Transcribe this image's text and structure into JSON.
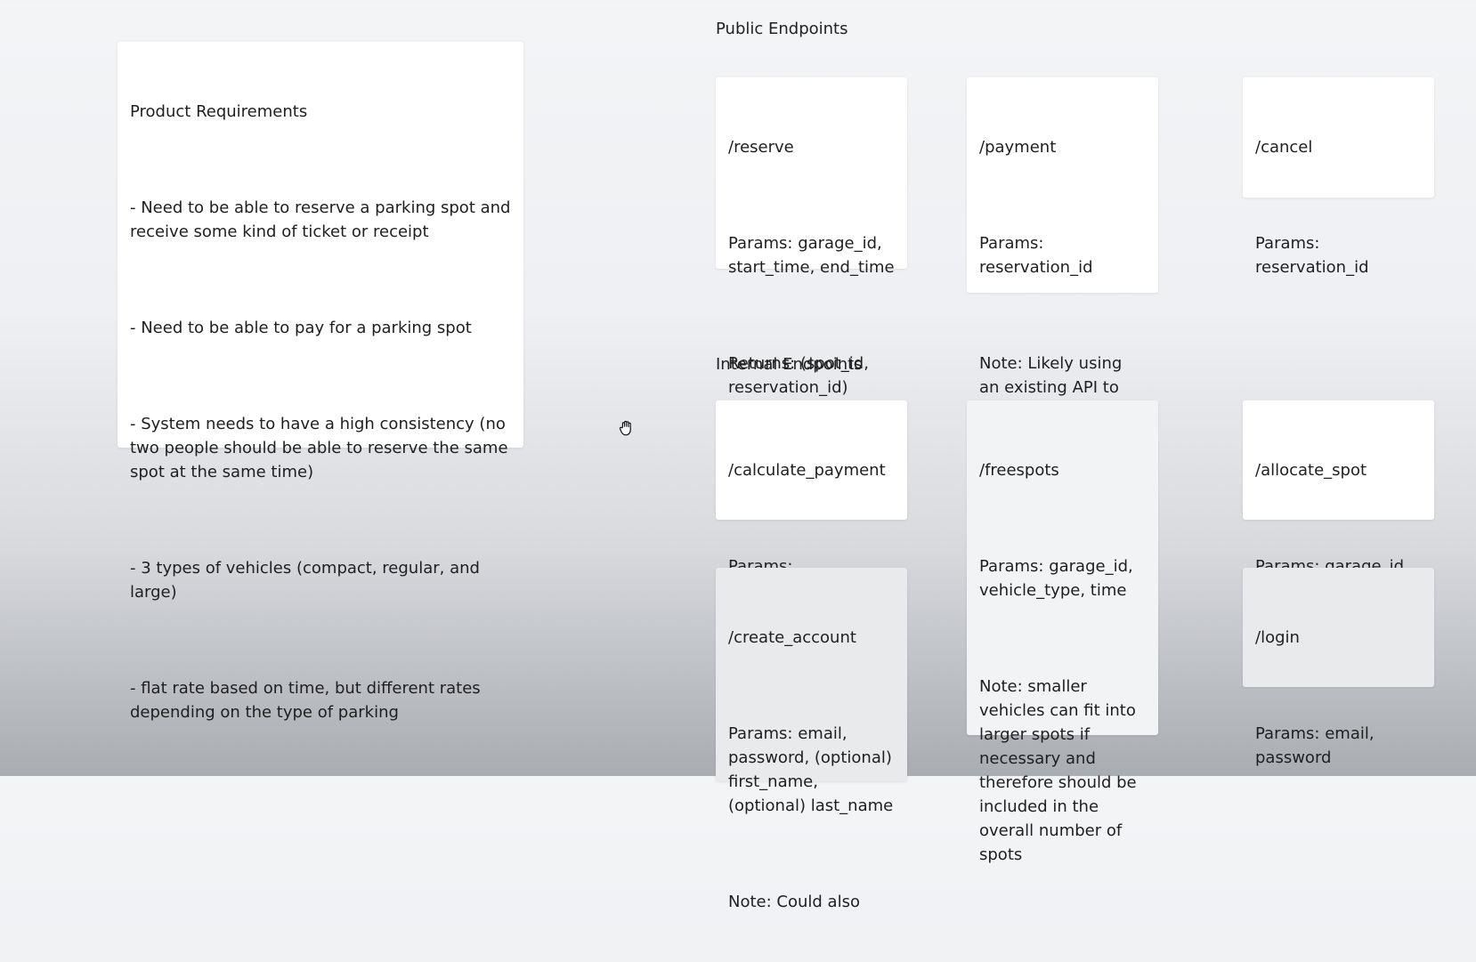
{
  "requirements": {
    "title": "Product Requirements",
    "items": [
      "- Need to be able to reserve a parking spot and receive some kind of ticket or receipt",
      "- Need to be able to pay for a parking spot",
      "- System needs to have a high consistency (no two people should be able to reserve the same spot at the same time)",
      "- 3 types of vehicles (compact, regular, and large)",
      "- flat rate based on time, but different rates depending on the type of parking"
    ]
  },
  "public": {
    "title": "Public Endpoints",
    "reserve": {
      "name": "/reserve",
      "params": "Params: garage_id, start_time, end_time",
      "returns": "Returns: (spot_id, reservation_id)"
    },
    "payment": {
      "name": "/payment",
      "params": "Params: reservation_id",
      "note": "Note: Likely using an existing API to handle (Stripe, Square, etc...)"
    },
    "cancel": {
      "name": "/cancel",
      "params": "Params: reservation_id"
    }
  },
  "internal": {
    "title": "Internal Endpoints",
    "calculate_payment": {
      "name": "/calculate_payment",
      "params": "Params: reservation_id"
    },
    "freespots": {
      "name": "/freespots",
      "params": "Params: garage_id, vehicle_type, time",
      "note": "Note: smaller vehicles can fit into larger spots if necessary and therefore should be included in the overall number of spots"
    },
    "allocate_spot": {
      "name": "/allocate_spot",
      "params": "Params: garage_id, vehicle_type, time"
    },
    "create_account": {
      "name": "/create_account",
      "params": "Params: email, password, (optional) first_name, (optional) last_name",
      "note": "Note: Could also"
    },
    "login": {
      "name": "/login",
      "params": "Params: email, password"
    }
  },
  "cursor": {
    "icon": "grab-hand-icon"
  }
}
